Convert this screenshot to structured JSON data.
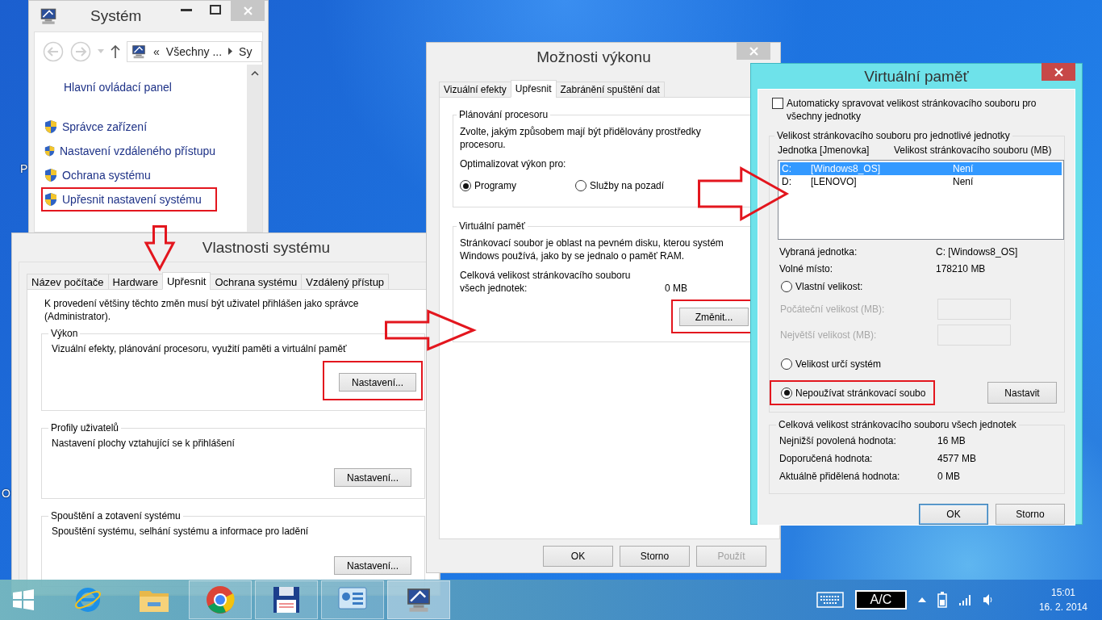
{
  "desktop": {
    "icon_labels": [
      "P",
      "O"
    ]
  },
  "system_window": {
    "title": "Systém",
    "breadcrumb": [
      "«",
      "Všechny ...",
      "Sy"
    ],
    "home_link": "Hlavní ovládací panel",
    "links": [
      {
        "label": "Správce zařízení",
        "highlighted": false
      },
      {
        "label": "Nastavení vzdáleného přístupu",
        "highlighted": false
      },
      {
        "label": "Ochrana systému",
        "highlighted": false
      },
      {
        "label": "Upřesnit nastavení systému",
        "highlighted": true
      }
    ]
  },
  "system_properties": {
    "title": "Vlastnosti systému",
    "tabs": [
      {
        "label": "Název počítače",
        "selected": false
      },
      {
        "label": "Hardware",
        "selected": false
      },
      {
        "label": "Upřesnit",
        "selected": true
      },
      {
        "label": "Ochrana systému",
        "selected": false
      },
      {
        "label": "Vzdálený přístup",
        "selected": false
      }
    ],
    "note": "K provedení většiny těchto změn musí být uživatel přihlášen jako správce (Administrator).",
    "groups": [
      {
        "title": "Výkon",
        "description": "Vizuální efekty, plánování procesoru, využití paměti a virtuální paměť",
        "button": "Nastavení...",
        "highlighted": true
      },
      {
        "title": "Profily uživatelů",
        "description": "Nastavení plochy vztahující se k přihlášení",
        "button": "Nastavení...",
        "highlighted": false
      },
      {
        "title": "Spouštění a zotavení systému",
        "description": "Spouštění systému, selhání systému a informace pro ladění",
        "button": "Nastavení...",
        "highlighted": false
      }
    ]
  },
  "performance_options": {
    "title": "Možnosti výkonu",
    "tabs": [
      {
        "label": "Vizuální efekty",
        "selected": false
      },
      {
        "label": "Upřesnit",
        "selected": true
      },
      {
        "label": "Zabránění spuštění dat",
        "selected": false
      }
    ],
    "processor_group": {
      "title": "Plánování procesoru",
      "description": "Zvolte, jakým způsobem mají být přidělovány prostředky procesoru.",
      "prompt": "Optimalizovat výkon pro:",
      "options": [
        {
          "label": "Programy",
          "selected": true
        },
        {
          "label": "Služby na pozadí",
          "selected": false
        }
      ]
    },
    "virtual_memory_group": {
      "title": "Virtuální paměť",
      "description": "Stránkovací soubor je oblast na pevném disku, kterou systém Windows používá, jako by se jednalo o paměť RAM.",
      "total_label": "Celková velikost stránkovacího souboru všech jednotek:",
      "total_value": "0 MB",
      "button": "Změnit...",
      "highlighted": true
    },
    "buttons": [
      {
        "label": "OK",
        "disabled": false
      },
      {
        "label": "Storno",
        "disabled": false
      },
      {
        "label": "Použít",
        "disabled": true
      }
    ]
  },
  "virtual_memory": {
    "title": "Virtuální paměť",
    "auto_manage": {
      "label": "Automaticky spravovat velikost stránkovacího souboru pro všechny jednotky",
      "checked": false
    },
    "drives_group": {
      "title": "Velikost stránkovacího souboru pro jednotlivé jednotky",
      "columns": [
        "Jednotka [Jmenovka]",
        "Velikost stránkovacího souboru (MB)"
      ],
      "drives": [
        {
          "drive": "C:",
          "label": "[Windows8_OS]",
          "size": "Není",
          "selected": true
        },
        {
          "drive": "D:",
          "label": "[LENOVO]",
          "size": "Není",
          "selected": false
        }
      ],
      "info": [
        {
          "label": "Vybraná jednotka:",
          "value": "C:  [Windows8_OS]"
        },
        {
          "label": "Volné místo:",
          "value": "178210 MB"
        }
      ],
      "options": [
        {
          "kind": "radio",
          "label": "Vlastní velikost:",
          "selected": false,
          "highlighted": false
        },
        {
          "kind": "field",
          "label": "Počáteční velikost (MB):",
          "disabled": true
        },
        {
          "kind": "field",
          "label": "Největší velikost (MB):",
          "disabled": true
        },
        {
          "kind": "radio",
          "label": "Velikost určí systém",
          "selected": false,
          "highlighted": false
        },
        {
          "kind": "radio",
          "label": "Nepoužívat stránkovací soubo",
          "selected": true,
          "highlighted": true
        }
      ],
      "set_button": "Nastavit"
    },
    "totals_group": {
      "title": "Celková velikost stránkovacího souboru všech jednotek",
      "rows": [
        {
          "label": "Nejnižší povolená hodnota:",
          "value": "16 MB"
        },
        {
          "label": "Doporučená hodnota:",
          "value": "4577 MB"
        },
        {
          "label": "Aktuálně přidělená hodnota:",
          "value": "0 MB"
        }
      ]
    },
    "buttons": [
      {
        "label": "OK",
        "default": true
      },
      {
        "label": "Storno",
        "default": false
      }
    ]
  },
  "taskbar": {
    "apps": [
      {
        "kind": "ie",
        "running": false,
        "active": false
      },
      {
        "kind": "folder",
        "running": false,
        "active": false
      },
      {
        "kind": "chrome",
        "running": true,
        "active": false
      },
      {
        "kind": "floppy",
        "running": true,
        "active": false
      },
      {
        "kind": "panel",
        "running": true,
        "active": false
      },
      {
        "kind": "system",
        "running": true,
        "active": true
      }
    ],
    "power": "A/C",
    "time": "15:01",
    "date": "16. 2. 2014"
  }
}
